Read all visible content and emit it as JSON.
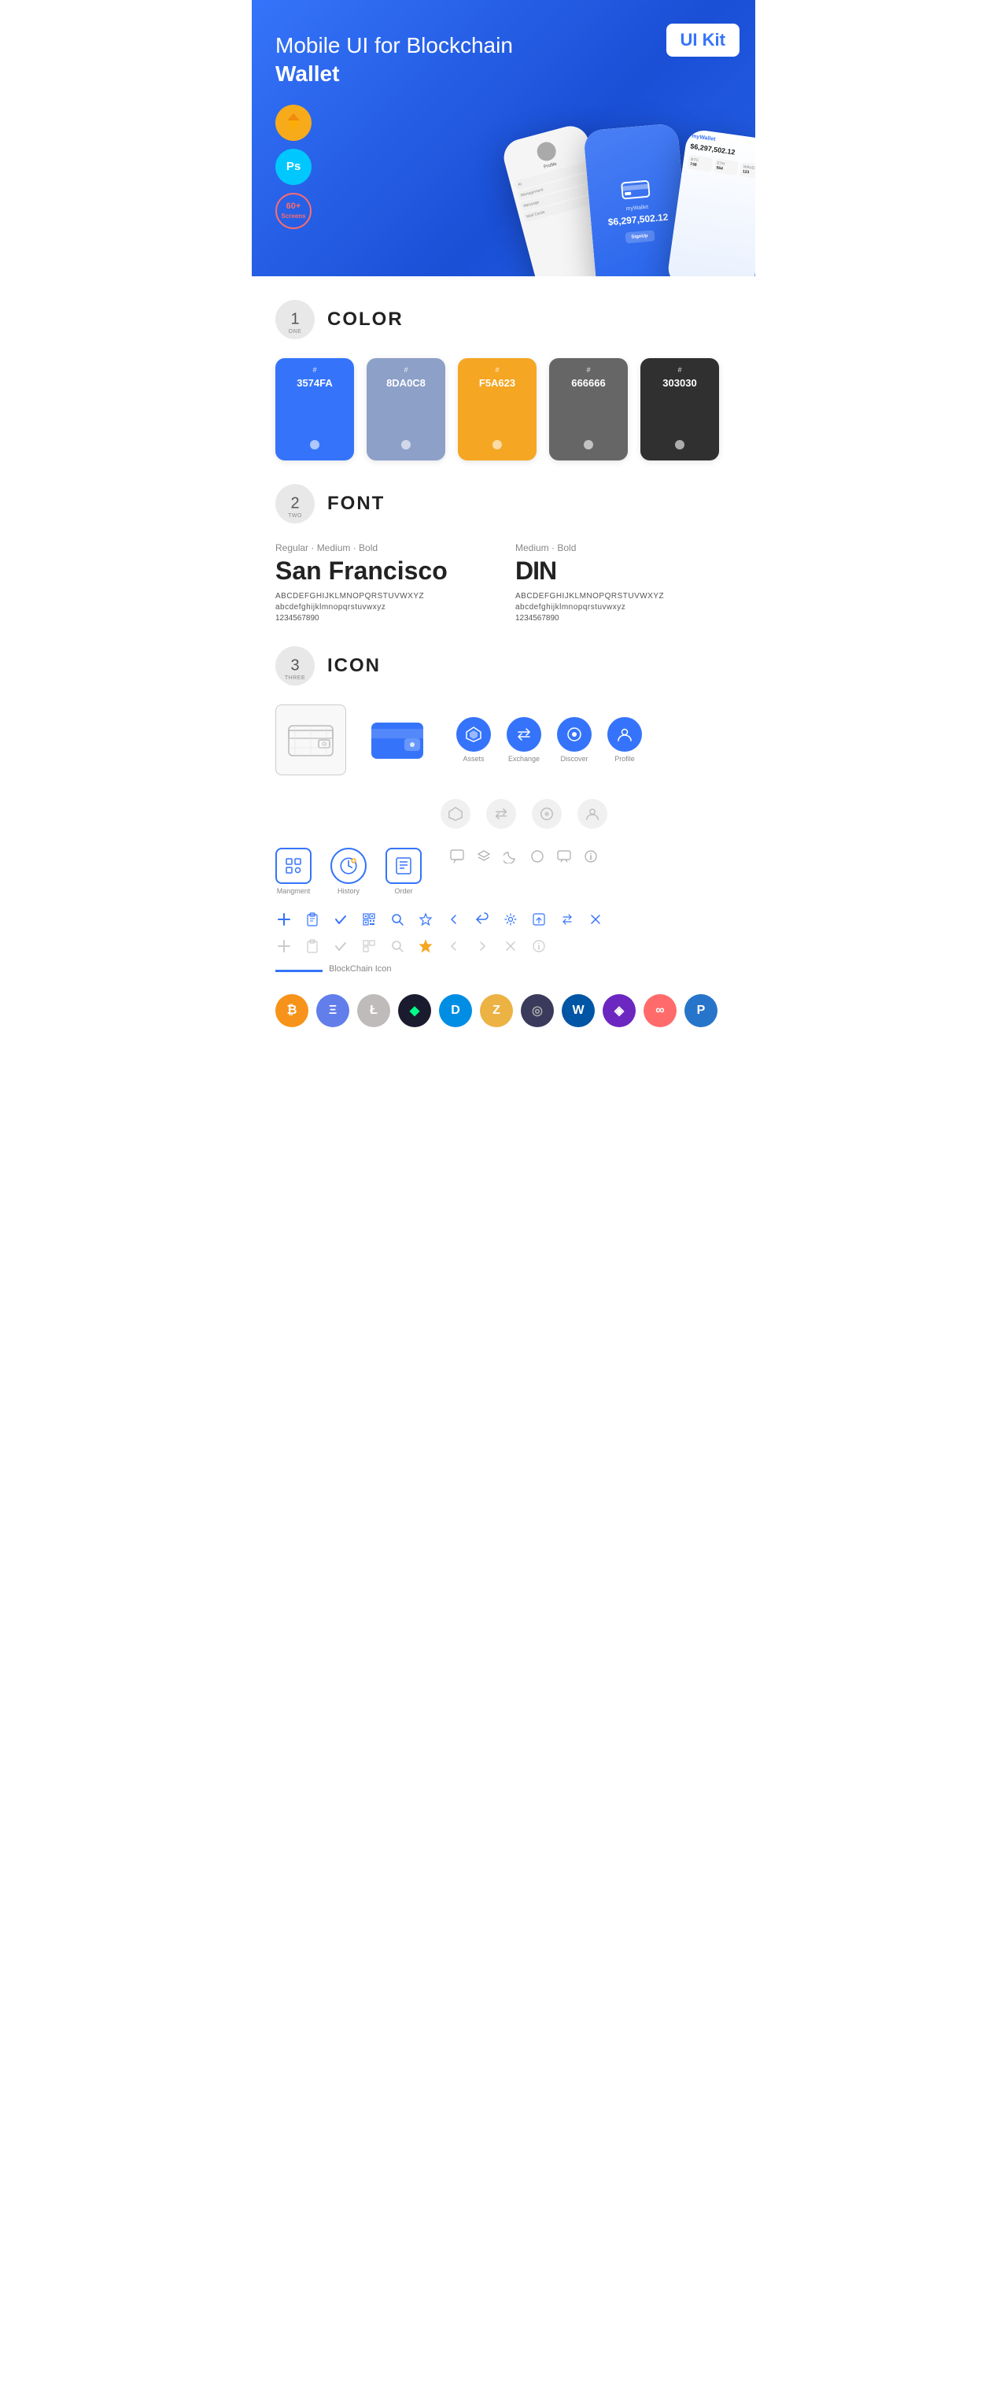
{
  "hero": {
    "title": "Mobile UI for Blockchain ",
    "title_bold": "Wallet",
    "badge": "UI Kit",
    "sketch_label": "Sketch",
    "ps_label": "Ps",
    "screens_label": "60+\nScreens"
  },
  "section1": {
    "number": "1",
    "label": "ONE",
    "title": "COLOR"
  },
  "colors": [
    {
      "code": "#",
      "hex": "3574FA",
      "bg": "#3574FA"
    },
    {
      "code": "#",
      "hex": "8DA0C8",
      "bg": "#8DA0C8"
    },
    {
      "code": "#",
      "hex": "F5A623",
      "bg": "#F5A623"
    },
    {
      "code": "#",
      "hex": "666666",
      "bg": "#666666"
    },
    {
      "code": "#",
      "hex": "303030",
      "bg": "#303030"
    }
  ],
  "section2": {
    "number": "2",
    "label": "TWO",
    "title": "FONT"
  },
  "fonts": [
    {
      "styles": "Regular · Medium · Bold",
      "name": "San Francisco",
      "uppercase": "ABCDEFGHIJKLMNOPQRSTUVWXYZ",
      "lowercase": "abcdefghijklmnopqrstuvwxyz",
      "numbers": "1234567890"
    },
    {
      "styles": "Medium · Bold",
      "name": "DIN",
      "uppercase": "ABCDEFGHIJKLMNOPQRSTUVWXYZ",
      "lowercase": "abcdefghijklmnopqrstuvwxyz",
      "numbers": "1234567890"
    }
  ],
  "section3": {
    "number": "3",
    "label": "THREE",
    "title": "ICON"
  },
  "icons": {
    "nav_labeled": [
      "Assets",
      "Exchange",
      "Discover",
      "Profile"
    ],
    "nav_bottom": [
      "Mangment",
      "History",
      "Order"
    ],
    "util_row1": [
      "+",
      "📋",
      "✓",
      "⊞",
      "🔍",
      "☆",
      "<",
      "⇐",
      "⚙",
      "↗",
      "⇌",
      "✕"
    ],
    "blockchain_label": "BlockChain Icon",
    "cryptos": [
      {
        "symbol": "₿",
        "bg": "#F7931A",
        "color": "#fff",
        "name": "Bitcoin"
      },
      {
        "symbol": "Ξ",
        "bg": "#627EEA",
        "color": "#fff",
        "name": "Ethereum"
      },
      {
        "symbol": "Ł",
        "bg": "#BFBBBB",
        "color": "#fff",
        "name": "Litecoin"
      },
      {
        "symbol": "◈",
        "bg": "#1B1B2F",
        "color": "#00ff88",
        "name": "Neo"
      },
      {
        "symbol": "D",
        "bg": "#008DE4",
        "color": "#fff",
        "name": "Dash"
      },
      {
        "symbol": "Z",
        "bg": "#ECB244",
        "color": "#fff",
        "name": "Zcash"
      },
      {
        "symbol": "◎",
        "bg": "#1B1B2F",
        "color": "#aaa",
        "name": "Generic"
      },
      {
        "symbol": "⬡",
        "bg": "#2DAA59",
        "color": "#fff",
        "name": "Waves"
      },
      {
        "symbol": "◆",
        "bg": "#8A2BE2",
        "color": "#fff",
        "name": "Verge"
      },
      {
        "symbol": "∞",
        "bg": "#FF6B6B",
        "color": "#fff",
        "name": "Band"
      },
      {
        "symbol": "P",
        "bg": "#2775CA",
        "color": "#fff",
        "name": "Polygon"
      }
    ]
  }
}
